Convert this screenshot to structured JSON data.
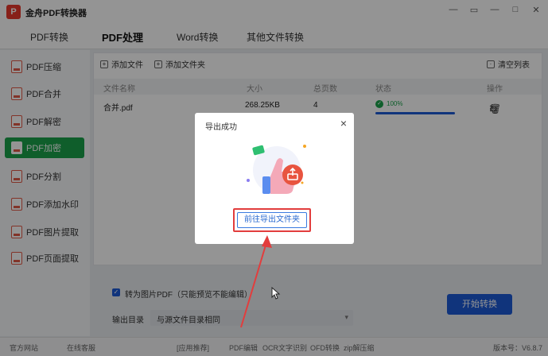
{
  "app": {
    "title": "金舟PDF转换器",
    "logo_letter": "P"
  },
  "window_controls": [
    "—",
    "▭",
    "—",
    "□",
    "✕"
  ],
  "tabs": [
    "PDF转换",
    "PDF处理",
    "Word转换",
    "其他文件转换"
  ],
  "active_tab": 1,
  "sidebar": {
    "items": [
      "PDF压缩",
      "PDF合并",
      "PDF解密",
      "PDF加密",
      "PDF分割",
      "PDF添加水印",
      "PDF图片提取",
      "PDF页面提取"
    ],
    "active_index": 3
  },
  "toolbar": {
    "add_file": "添加文件",
    "add_folder": "添加文件夹",
    "clear_list": "清空列表"
  },
  "table": {
    "headers": [
      "文件名称",
      "大小",
      "总页数",
      "状态",
      "操作"
    ],
    "rows": [
      {
        "name": "合并.pdf",
        "size": "268.25KB",
        "pages": "4",
        "status": "100%",
        "progress": 1.0
      }
    ]
  },
  "options": {
    "convert_to_image": "转为图片PDF（只能预览不能编辑）",
    "output_label": "输出目录",
    "output_value": "与源文件目录相同",
    "start_button": "开始转换"
  },
  "statusbar": {
    "website": "官方网站",
    "support": "在线客服",
    "recommend": "[应用推荐]",
    "links": [
      "PDF编辑",
      "OCR文字识别",
      "OFD转换",
      "zip解压缩"
    ],
    "version": "版本号：V6.8.7"
  },
  "dialog": {
    "title": "导出成功",
    "button": "前往导出文件夹"
  },
  "colors": {
    "accent_green": "#1aa34a",
    "primary_blue": "#1d5bd6",
    "highlight_red": "#e23d3d"
  }
}
